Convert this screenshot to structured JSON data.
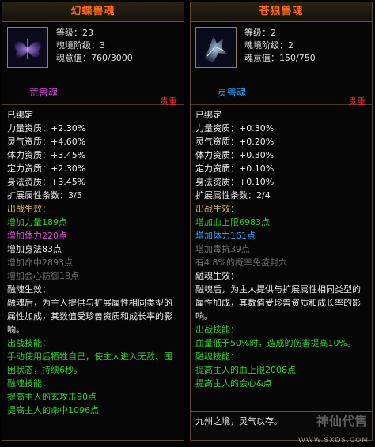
{
  "cards": [
    {
      "title": "幻蝶兽魂",
      "icon": "purple-butterfly-icon",
      "stats": [
        "等级：23",
        "魂境阶级：3",
        "魂意值：760/3000"
      ],
      "kind": "荒兽魂",
      "kind_color": "#d24ad2",
      "quality": "贵重",
      "lines": [
        {
          "t": "已绑定",
          "c": "w"
        },
        {
          "t": "力量资质：+2.30%",
          "c": "w"
        },
        {
          "t": "灵气资质：+4.60%",
          "c": "w"
        },
        {
          "t": "体力资质：+3.45%",
          "c": "w"
        },
        {
          "t": "定力资质：+2.30%",
          "c": "w"
        },
        {
          "t": "身法资质：+3.45%",
          "c": "w"
        },
        {
          "t": "扩展属性条数：3/5",
          "c": "w"
        },
        {
          "t": "出战生效：",
          "c": "y"
        },
        {
          "t": "增加力量189点",
          "c": "g"
        },
        {
          "t": "增加体力220点",
          "c": "pu"
        },
        {
          "t": "增加身法83点",
          "c": "w"
        },
        {
          "t": "增加命中2893点",
          "c": "gr"
        },
        {
          "t": "增加会心防御18点",
          "c": "gr"
        },
        {
          "t": "融魂生效：",
          "c": "w"
        },
        {
          "t": "融魂后，为主人提供与扩展属性相同类型的属性加成，其数值受珍兽资质和成长率的影响。",
          "c": "w",
          "wrap": true
        },
        {
          "t": "出战技能：",
          "c": "g"
        },
        {
          "t": "手动使用后牺牲自己，使主人进入无敌、围困状态，持续6秒。",
          "c": "g",
          "wrap": true
        },
        {
          "t": "融魂技能：",
          "c": "g"
        },
        {
          "t": "提高主人的玄攻击90点",
          "c": "g"
        },
        {
          "t": "提高主人的命中1096点",
          "c": "g"
        }
      ],
      "bottom": []
    },
    {
      "title": "苍狼兽魂",
      "icon": "blue-wolf-icon",
      "stats": [
        "等级：2",
        "魂境阶级：2",
        "魂意值：150/750"
      ],
      "kind": "灵兽魂",
      "kind_color": "#2ea8ff",
      "quality": "贵重",
      "lines": [
        {
          "t": "已绑定",
          "c": "w"
        },
        {
          "t": "力量资质：+0.30%",
          "c": "w"
        },
        {
          "t": "灵气资质：+0.20%",
          "c": "w"
        },
        {
          "t": "体力资质：+0.30%",
          "c": "w"
        },
        {
          "t": "定力资质：+0.10%",
          "c": "w"
        },
        {
          "t": "身法资质：+0.10%",
          "c": "w"
        },
        {
          "t": "扩展属性条数：2/4",
          "c": "w"
        },
        {
          "t": "出战生效：",
          "c": "y"
        },
        {
          "t": "增加血上限6983点",
          "c": "g"
        },
        {
          "t": "增加体力161点",
          "c": "bl"
        },
        {
          "t": "增加毒抗39点",
          "c": "gr"
        },
        {
          "t": "有4.8%的概率免疫封穴",
          "c": "gr"
        },
        {
          "t": "融魂生效：",
          "c": "w"
        },
        {
          "t": "融魂后，为主人提供与扩展属性相同类型的属性加成，其数值受珍兽资质和成长率的影响。",
          "c": "w",
          "wrap": true
        },
        {
          "t": "出战技能：",
          "c": "g"
        },
        {
          "t": "血量低于50%时，造成的伤害提高10%。",
          "c": "g"
        },
        {
          "t": "融魂技能：",
          "c": "g"
        },
        {
          "t": "提高主人的血上限2008点",
          "c": "g"
        },
        {
          "t": "提高主人的会心&点",
          "c": "g"
        }
      ],
      "bottom": [
        "九州之境，灵气以存。"
      ]
    }
  ],
  "watermark": "神仙代售",
  "site": "WWW.SXDS.COM"
}
